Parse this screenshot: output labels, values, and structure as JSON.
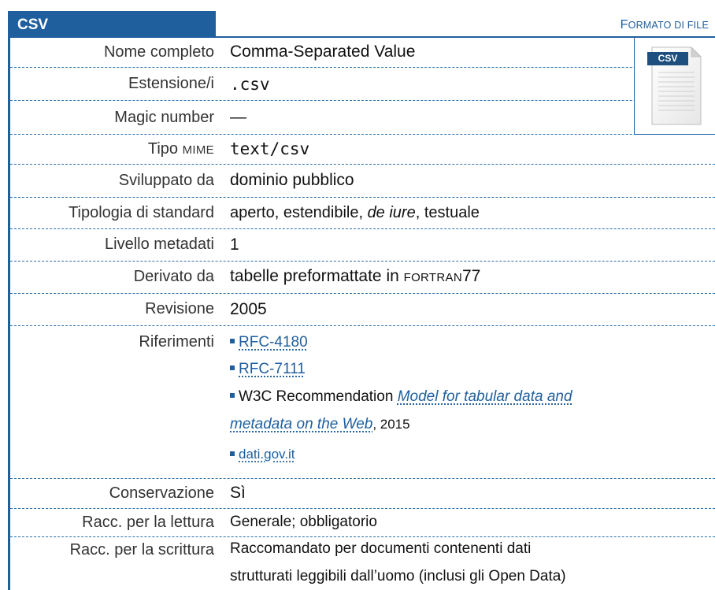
{
  "header": {
    "title": "CSV",
    "category_first": "F",
    "category_rest": "ORMATO DI FILE"
  },
  "icon": {
    "label": "CSV"
  },
  "rows": {
    "nome_completo": {
      "label": "Nome completo",
      "value": "Comma-Separated Value"
    },
    "estensione": {
      "label": "Estensione/i",
      "value": ".csv"
    },
    "magic_number": {
      "label": "Magic number",
      "value": "—"
    },
    "tipo_mime": {
      "label_a": "Tipo ",
      "label_b": "MIME",
      "value": "text/csv"
    },
    "sviluppato_da": {
      "label": "Sviluppato da",
      "value": "dominio pubblico"
    },
    "tipologia": {
      "label": "Tipologia di standard",
      "value_a": "aperto, estendibile, ",
      "value_b": "de iure",
      "value_c": ", testuale"
    },
    "livello_metadati": {
      "label": "Livello metadati",
      "value": "1"
    },
    "derivato_da": {
      "label": "Derivato da",
      "value_a": "tabelle preformattate in ",
      "value_b": "FORTRAN",
      "value_c": "77"
    },
    "revisione": {
      "label": "Revisione",
      "value": "2005"
    },
    "riferimenti": {
      "label": "Riferimenti",
      "ref1": "RFC-4180",
      "ref2": "RFC-7111",
      "ref3_prefix": "W3C Recommendation ",
      "ref3_title_line1": "Model for tabular data and",
      "ref3_title_line2": "metadata on the Web",
      "ref3_suffix": ",  2015",
      "ref4": "dati.gov.it"
    },
    "conservazione": {
      "label": "Conservazione",
      "value": "Sì"
    },
    "racc_lettura": {
      "label": "Racc. per la lettura",
      "value": "Generale; obbligatorio"
    },
    "racc_scrittura": {
      "label": "Racc. per la scrittura",
      "value_line1": "Raccomandato per documenti contenenti dati",
      "value_line2": "strutturati leggibili dall’uomo (inclusi gli Open Data)"
    }
  },
  "colors": {
    "accent": "#1f5f9e"
  }
}
